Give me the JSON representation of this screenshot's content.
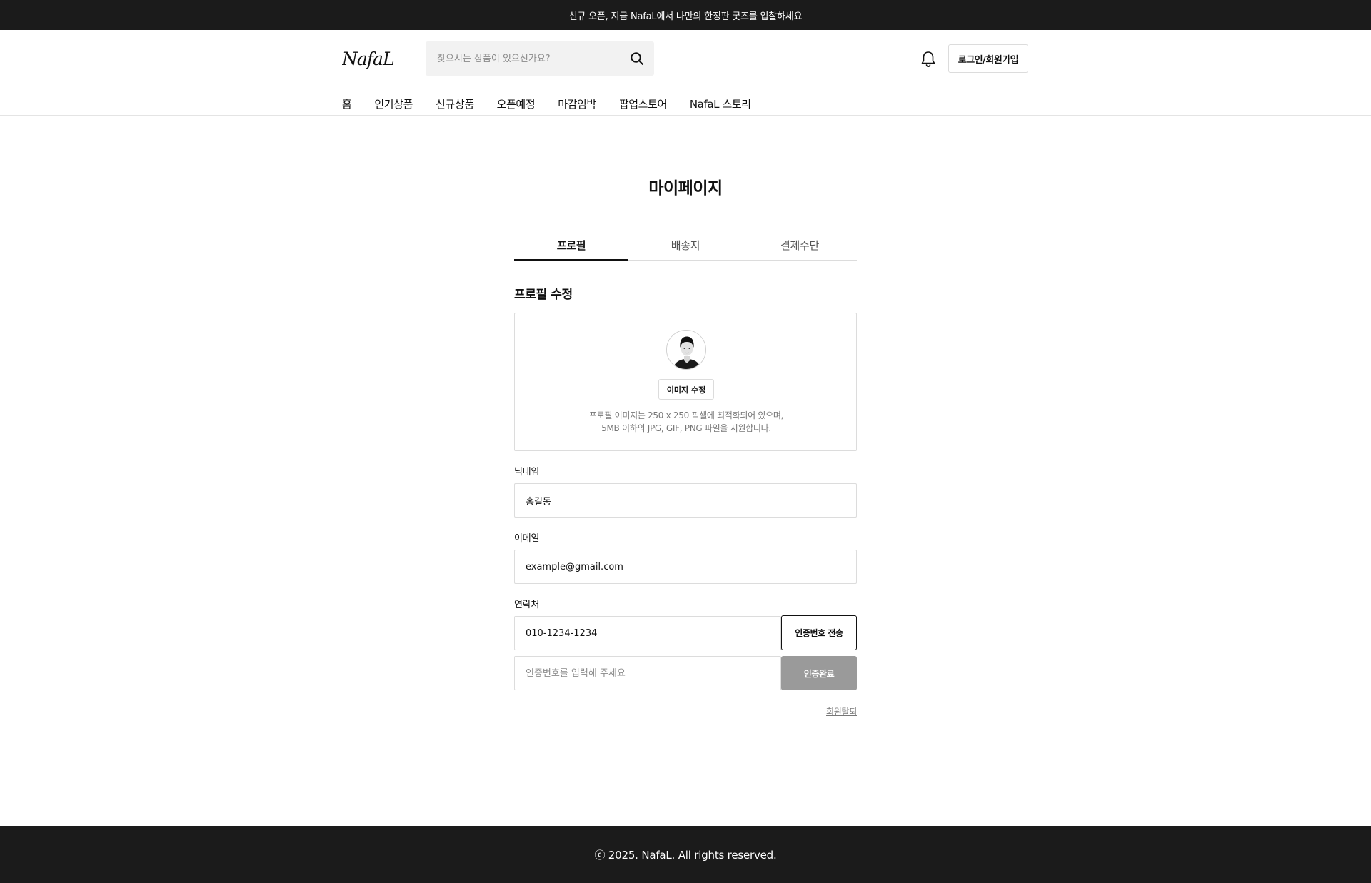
{
  "banner": {
    "text": "신규 오픈, 지금 NafaL에서 나만의 한정판 굿즈를 입찰하세요"
  },
  "header": {
    "logo_text": "NafaL",
    "search_placeholder": "찾으시는 상품이 있으신가요?",
    "login_label": "로그인/회원가입"
  },
  "nav": {
    "items": [
      {
        "label": "홈"
      },
      {
        "label": "인기상품"
      },
      {
        "label": "신규상품"
      },
      {
        "label": "오픈예정"
      },
      {
        "label": "마감임박"
      },
      {
        "label": "팝업스토어"
      },
      {
        "label": "NafaL 스토리"
      }
    ]
  },
  "page": {
    "title": "마이페이지"
  },
  "tabs": [
    {
      "label": "프로필",
      "active": true
    },
    {
      "label": "배송지",
      "active": false
    },
    {
      "label": "결제수단",
      "active": false
    }
  ],
  "profile": {
    "section_title": "프로필 수정",
    "edit_image_label": "이미지 수정",
    "help_line1": "프로필 이미지는 250 x 250 픽셀에 최적화되어 있으며,",
    "help_line2": "5MB 이하의 JPG, GIF, PNG 파일을 지원합니다."
  },
  "form": {
    "nickname_label": "닉네임",
    "nickname_value": "홍길동",
    "email_label": "이메일",
    "email_value": "example@gmail.com",
    "phone_label": "연락처",
    "phone_value": "010-1234-1234",
    "send_code_label": "인증번호 전송",
    "code_placeholder": "인증번호를 입력해 주세요",
    "verify_done_label": "인증완료",
    "withdraw_label": "회원탈퇴"
  },
  "footer": {
    "text": "ⓒ 2025. NafaL. All rights reserved."
  },
  "icons": {
    "search": "search-icon",
    "bell": "bell-icon",
    "avatar": "avatar-image"
  },
  "colors": {
    "dark_bar": "#1b1b1b",
    "disabled_button": "#9a9a9a",
    "border": "#dcdcdc"
  }
}
